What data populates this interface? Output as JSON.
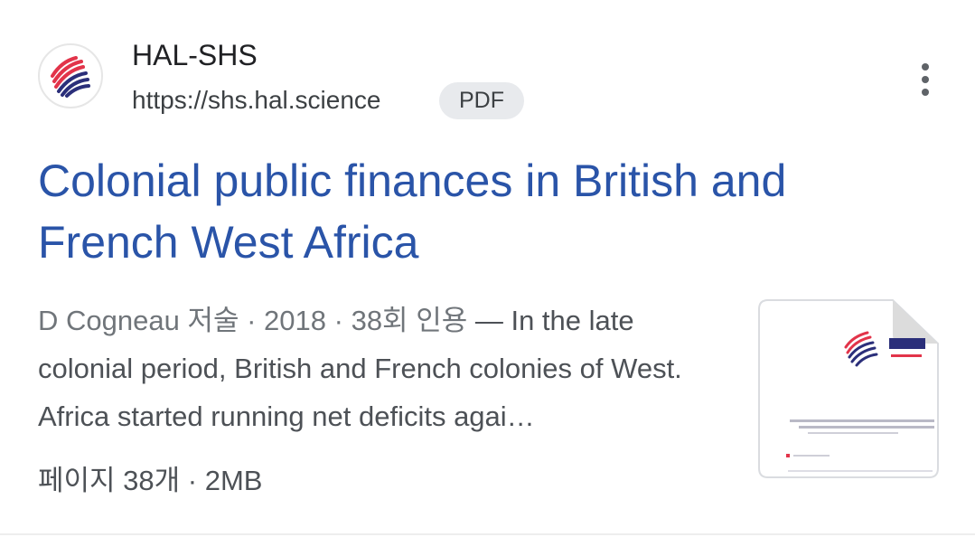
{
  "result": {
    "site_name": "HAL-SHS",
    "site_url": "https://shs.hal.science",
    "file_type_badge": "PDF",
    "favicon_icon": "hal-logo-icon",
    "more_icon": "more-vert-icon",
    "title": "Colonial public finances in British and French West Africa",
    "snippet": {
      "author": "D Cogneau 저술",
      "year": "2018",
      "citations": "38회 인용",
      "separator": " · ",
      "dash": " — ",
      "text": "In the late colonial period, British and French colonies of West. Africa started running net deficits agai…"
    },
    "file_meta": "페이지 38개 · 2MB",
    "thumbnail_icon": "document-thumbnail-icon"
  },
  "colors": {
    "title": "#2a54a8",
    "snippet": "#4d5156",
    "badge_bg": "#e8eaed",
    "logo_red": "#e2344a",
    "logo_navy": "#2b2f7a"
  }
}
